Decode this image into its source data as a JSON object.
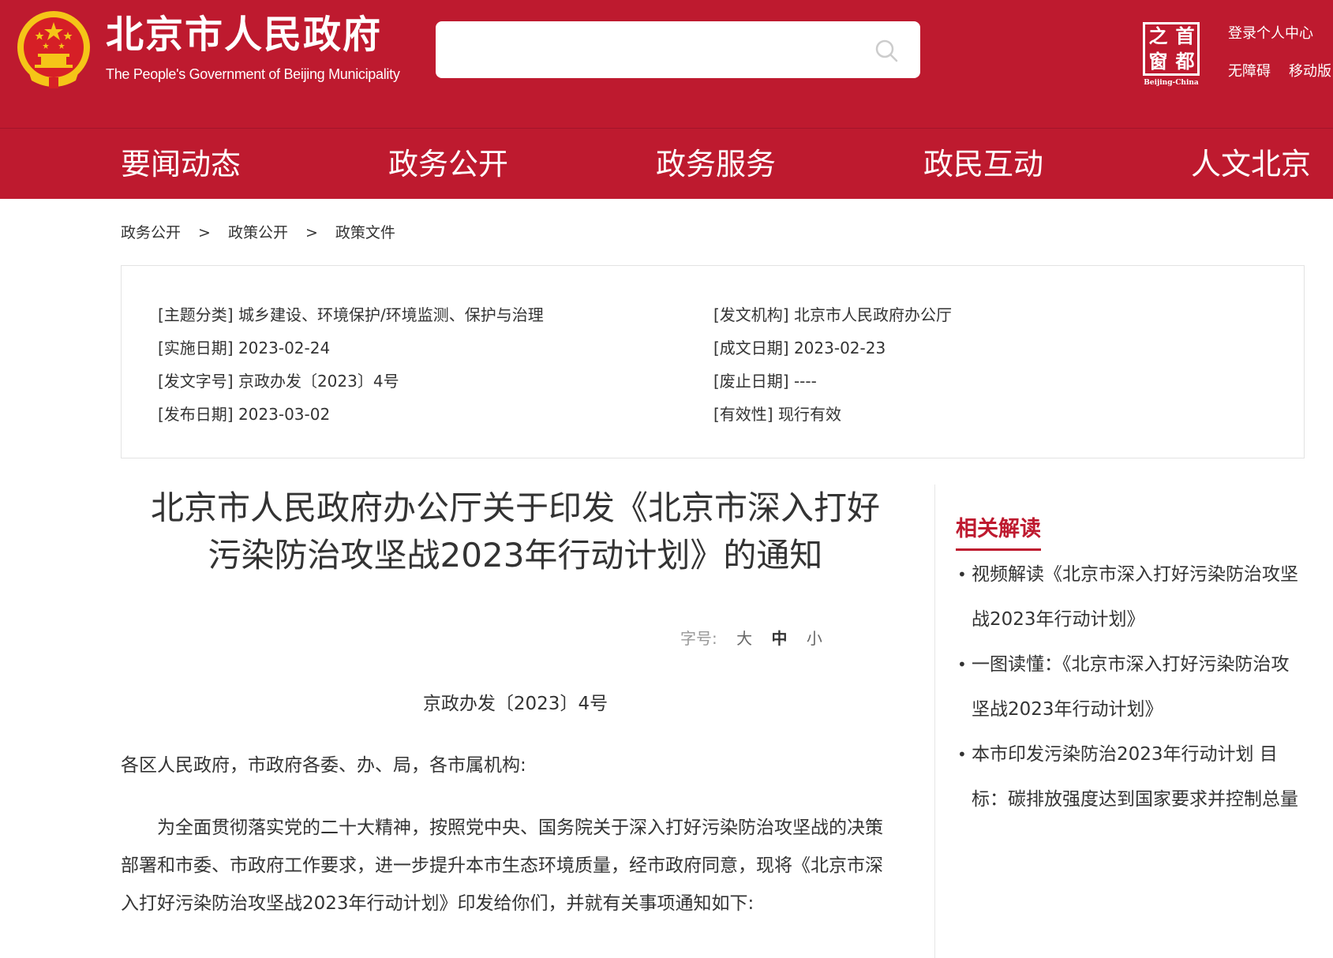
{
  "header": {
    "site_title": "北京市人民政府",
    "site_subtitle": "The People's Government of Beijing Municipality",
    "search_placeholder": "",
    "capital_logo": {
      "chars": [
        "之",
        "首",
        "窗",
        "都"
      ],
      "en": "Beijing-China"
    },
    "login_link": "登录个人中心",
    "accessibility_link": "无障碍",
    "mobile_link": "移动版"
  },
  "nav": {
    "items": [
      "要闻动态",
      "政务公开",
      "政务服务",
      "政民互动",
      "人文北京"
    ]
  },
  "breadcrumb": {
    "items": [
      "政务公开",
      "政策公开",
      "政策文件"
    ],
    "separator": ">"
  },
  "meta": {
    "topic": "[主题分类] 城乡建设、环境保护/环境监测、保护与治理",
    "issuer": "[发文机构] 北京市人民政府办公厅",
    "effective_date": "[实施日期] 2023-02-24",
    "written_date": "[成文日期] 2023-02-23",
    "doc_number": "[发文字号] 京政办发〔2023〕4号",
    "repeal_date": "[废止日期] ----",
    "publish_date": "[发布日期] 2023-03-02",
    "validity": "[有效性] 现行有效"
  },
  "article": {
    "title_line1": "北京市人民政府办公厅关于印发《北京市深入打好",
    "title_line2": "污染防治攻坚战2023年行动计划》的通知",
    "font_size_label": "字号:",
    "font_size_options": [
      "大",
      "中",
      "小"
    ],
    "doc_number": "京政办发〔2023〕4号",
    "salutation": "各区人民政府，市政府各委、办、局，各市属机构:",
    "paragraph": "为全面贯彻落实党的二十大精神，按照党中央、国务院关于深入打好污染防治攻坚战的决策部署和市委、市政府工作要求，进一步提升本市生态环境质量，经市政府同意，现将《北京市深入打好污染防治攻坚战2023年行动计划》印发给你们，并就有关事项通知如下:"
  },
  "sidebar": {
    "title": "相关解读",
    "items": [
      "视频解读《北京市深入打好污染防治攻坚战2023年行动计划》",
      "一图读懂：《北京市深入打好污染防治攻坚战2023年行动计划》",
      "本市印发污染防治2023年行动计划 目标：碳排放强度达到国家要求并控制总量"
    ]
  },
  "colors": {
    "brand_red": "#be1a2f",
    "emblem_gold": "#f5c518"
  }
}
